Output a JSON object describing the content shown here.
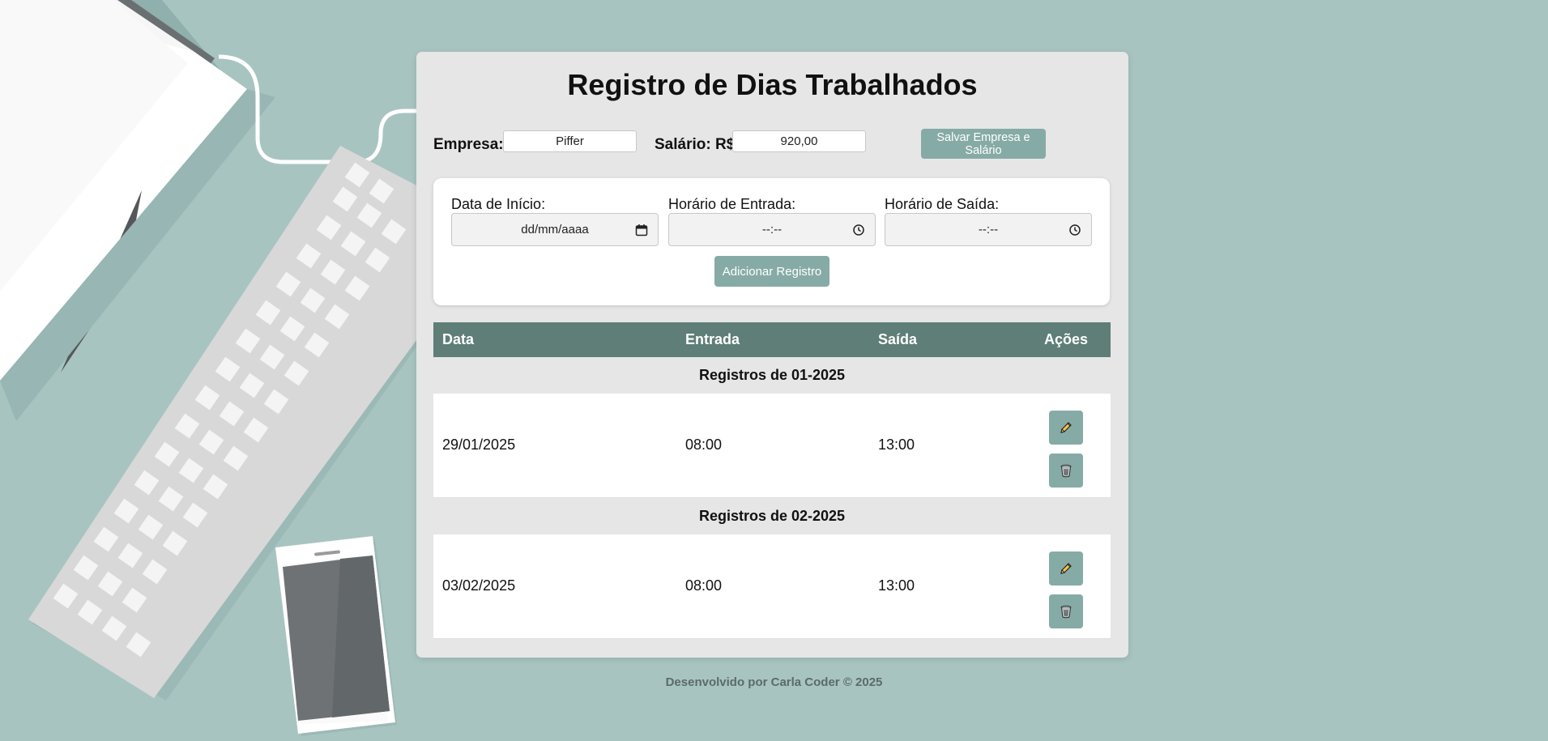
{
  "app": {
    "title": "Registro de Dias Trabalhados"
  },
  "company_bar": {
    "company_label": "Empresa:",
    "company_value": "Piffer",
    "salary_label": "Salário: R$",
    "salary_value": "920,00",
    "save_button": "Salvar Empresa e Salário"
  },
  "form": {
    "date_label": "Data de Início:",
    "date_placeholder": "dd/mm/aaaa",
    "entry_label": "Horário de Entrada:",
    "entry_placeholder": "--:--",
    "exit_label": "Horário de Saída:",
    "exit_placeholder": "--:--",
    "add_button": "Adicionar Registro"
  },
  "table": {
    "columns": [
      "Data",
      "Entrada",
      "Saída",
      "Ações"
    ],
    "groups": [
      {
        "title": "Registros de 01-2025",
        "rows": [
          {
            "date": "29/01/2025",
            "entry": "08:00",
            "exit": "13:00"
          }
        ]
      },
      {
        "title": "Registros de 02-2025",
        "rows": [
          {
            "date": "03/02/2025",
            "entry": "08:00",
            "exit": "13:00"
          }
        ]
      }
    ]
  },
  "icons": {
    "edit": "pencil-icon",
    "delete": "trash-icon",
    "calendar": "calendar-icon",
    "clock": "clock-icon"
  },
  "colors": {
    "background": "#a8c4c1",
    "accent": "#86aba6",
    "table_header": "#5e7e77"
  },
  "footer": {
    "text": "Desenvolvido por Carla Coder © 2025"
  }
}
